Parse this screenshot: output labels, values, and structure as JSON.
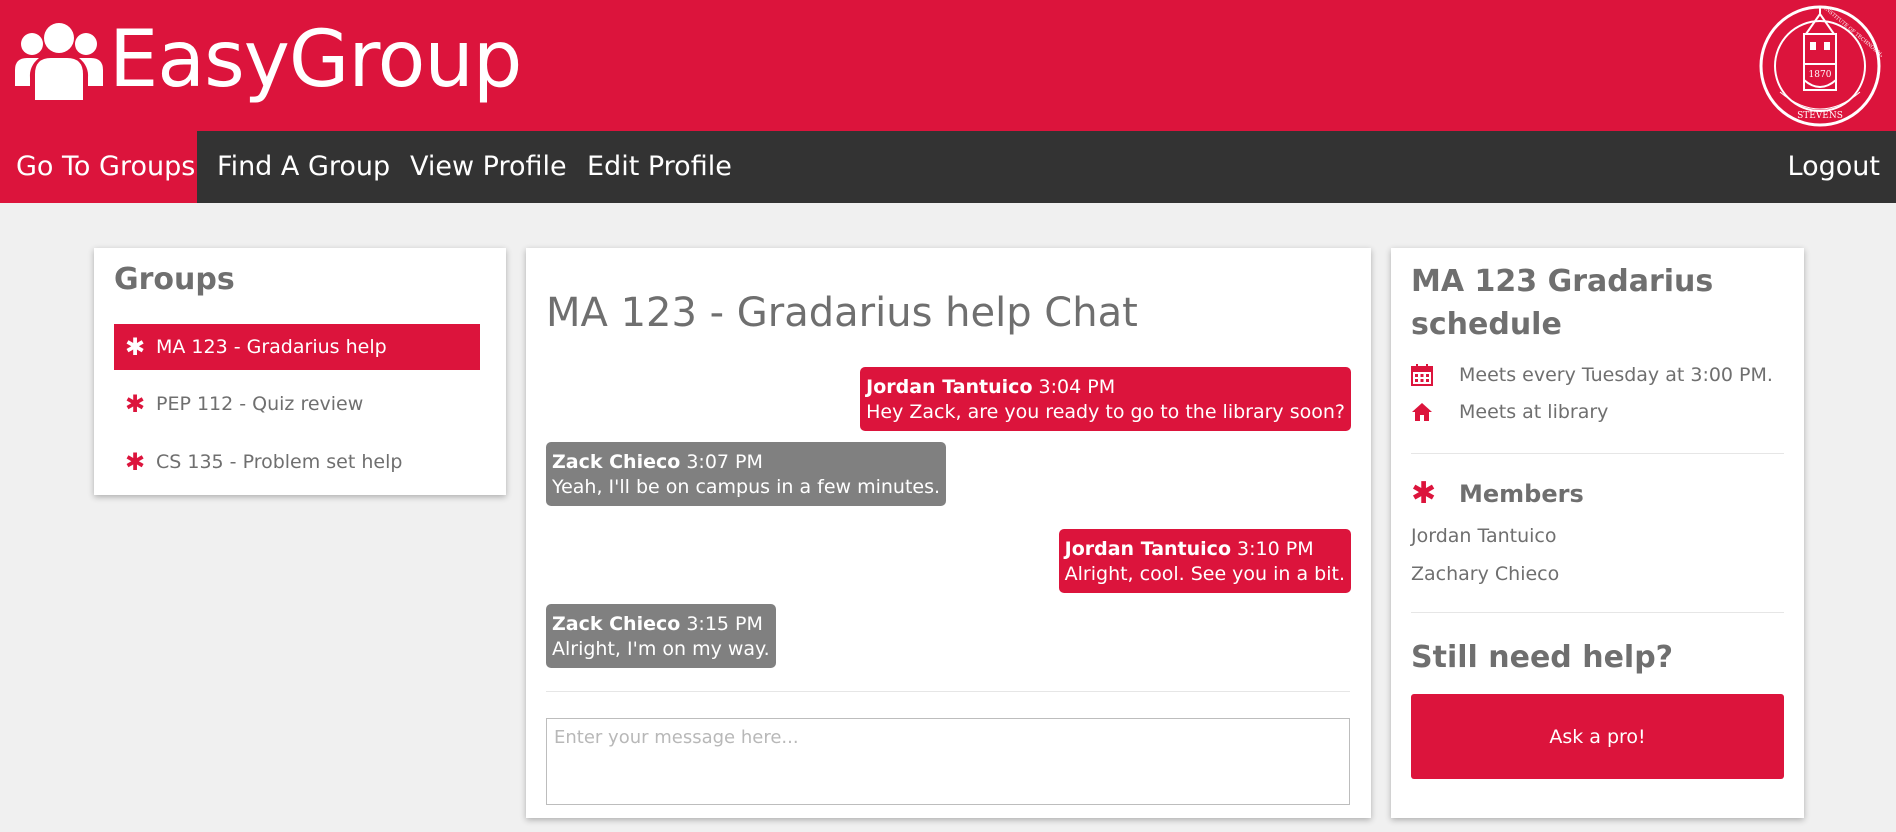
{
  "colors": {
    "brand": "#dc143c",
    "nav_bg": "#333333",
    "page_bg": "#f0f0f0",
    "bubble_other": "#808080"
  },
  "header": {
    "title": "EasyGroup",
    "logo_icon": "users-group-icon",
    "seal": {
      "icon": "stevens-seal-icon",
      "top_text": "INSTITUTE OF TECHNOLOGY",
      "bottom_text": "STEVENS",
      "year": "1870"
    }
  },
  "nav": {
    "items": [
      {
        "label": "Go To Groups",
        "active": true
      },
      {
        "label": "Find A Group",
        "active": false
      },
      {
        "label": "View Profile",
        "active": false
      },
      {
        "label": "Edit Profile",
        "active": false
      }
    ],
    "logout": "Logout"
  },
  "groups": {
    "title": "Groups",
    "items": [
      {
        "label": "MA 123 - Gradarius help",
        "icon": "asterisk-icon",
        "active": true
      },
      {
        "label": "PEP 112 - Quiz review",
        "icon": "asterisk-icon",
        "active": false
      },
      {
        "label": "CS 135 - Problem set help",
        "icon": "asterisk-icon",
        "active": false
      }
    ]
  },
  "chat": {
    "title": "MA 123 - Gradarius help Chat",
    "messages": [
      {
        "sender": "Jordan Tantuico",
        "time": "3:04 PM",
        "text": "Hey Zack, are you ready to go to the library soon?",
        "mine": true
      },
      {
        "sender": "Zack Chieco",
        "time": "3:07 PM",
        "text": "Yeah, I'll be on campus in a few minutes.",
        "mine": false
      },
      {
        "sender": "Jordan Tantuico",
        "time": "3:10 PM",
        "text": "Alright, cool. See you in a bit.",
        "mine": true
      },
      {
        "sender": "Zack Chieco",
        "time": "3:15 PM",
        "text": "Alright, I'm on my way.",
        "mine": false
      }
    ],
    "input_placeholder": "Enter your message here..."
  },
  "schedule": {
    "title": "MA 123 Gradarius schedule",
    "meets_time": "Meets every Tuesday at 3:00 PM.",
    "meets_place": "Meets at library",
    "time_icon": "calendar-icon",
    "place_icon": "home-icon"
  },
  "members": {
    "title": "Members",
    "icon": "asterisk-icon",
    "list": [
      "Jordan Tantuico",
      "Zachary Chieco"
    ]
  },
  "help": {
    "title": "Still need help?",
    "button": "Ask a pro!"
  }
}
